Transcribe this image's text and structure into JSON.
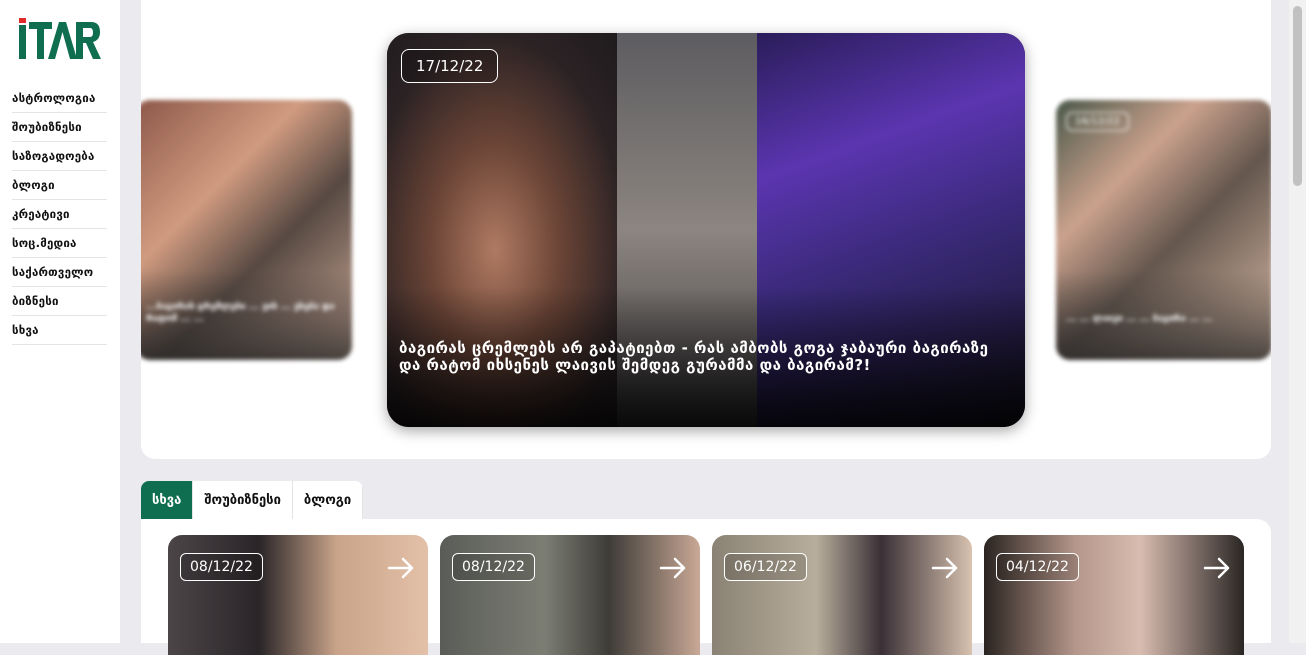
{
  "brand": {
    "logo_text": "iTAR",
    "accent": "#0e6e4f",
    "logo_red": "#e32a2a"
  },
  "sidebar": {
    "items": [
      {
        "label": "ასტროლოგია"
      },
      {
        "label": "შოუბიზნესი"
      },
      {
        "label": "საზოგადოება"
      },
      {
        "label": "ბლოგი"
      },
      {
        "label": "კრეატივი"
      },
      {
        "label": "სოც.მედია"
      },
      {
        "label": "საქართველო"
      },
      {
        "label": "ბიზნესი"
      },
      {
        "label": "სხვა"
      }
    ]
  },
  "hero": {
    "main": {
      "date": "17/12/22",
      "title": "ბაგირას ცრემლებს არ გაპატიებთ - რას ამბობს გოგა ჯაბაური ბაგირაზე და რატომ იხსენეს ლაივის შემდეგ გურამმა და ბაგირამ?!"
    },
    "left": {
      "text": "...ბაგირას ცრემლები ... ვის ... ეხება და რატომ ... ..."
    },
    "right": {
      "date": "16/12/22",
      "text": "... ... ლაივი ... ... ბაგირა ... ..."
    }
  },
  "tabs": [
    {
      "label": "სხვა",
      "active": true
    },
    {
      "label": "შოუბიზნესი",
      "active": false
    },
    {
      "label": "ბლოგი",
      "active": false
    }
  ],
  "news": [
    {
      "date": "08/12/22",
      "icon": "arrow-right-icon"
    },
    {
      "date": "08/12/22",
      "icon": "arrow-right-icon"
    },
    {
      "date": "06/12/22",
      "icon": "arrow-right-icon"
    },
    {
      "date": "04/12/22",
      "icon": "arrow-right-icon"
    }
  ]
}
